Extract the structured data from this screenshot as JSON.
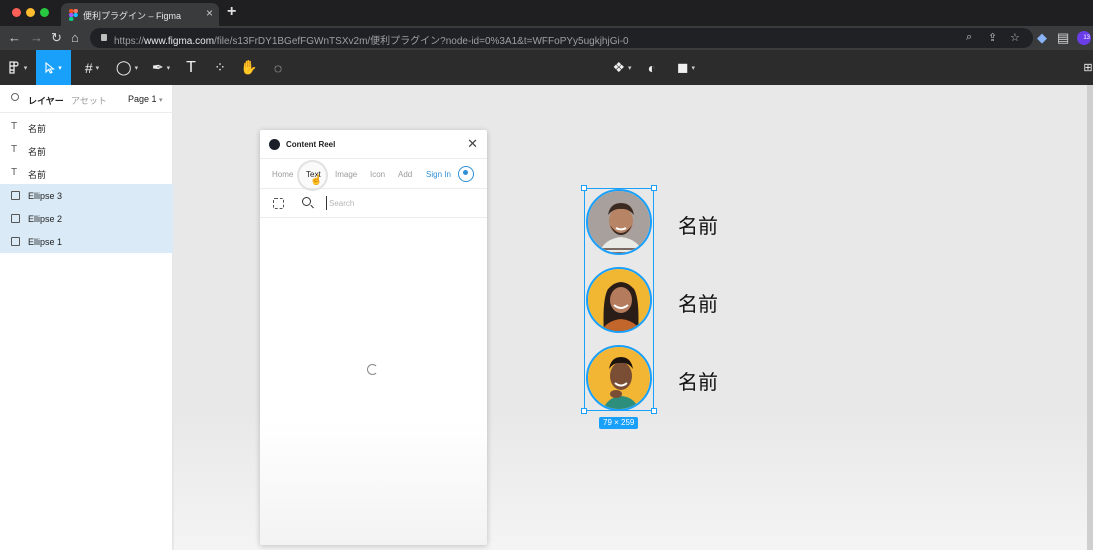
{
  "browser": {
    "tab_title": "便利プラグイン – Figma",
    "new_tab_glyph": "+",
    "url_prefix": "https://",
    "url_domain": "www.figma.com",
    "url_rest": "/file/s13FrDY1BGefFGWnTSXv2m/便利プラグイン?node-id=0%3A1&t=WFFoPYy5ugkjhjGi-0",
    "extension_badge": "13"
  },
  "layers_panel": {
    "tab_layers": "レイヤー",
    "tab_assets": "アセット",
    "page": "Page 1",
    "layers": [
      {
        "type": "text",
        "label": "名前",
        "selected": false
      },
      {
        "type": "text",
        "label": "名前",
        "selected": false
      },
      {
        "type": "text",
        "label": "名前",
        "selected": false
      },
      {
        "type": "image",
        "label": "Ellipse 3",
        "selected": true
      },
      {
        "type": "image",
        "label": "Ellipse 2",
        "selected": true
      },
      {
        "type": "image",
        "label": "Ellipse 1",
        "selected": true
      }
    ]
  },
  "plugin": {
    "title": "Content Reel",
    "close_glyph": "✕",
    "nav": [
      "Home",
      "Text",
      "Image",
      "Icon",
      "Add",
      "Sign In"
    ],
    "active_nav": "Text",
    "search_placeholder": "Search",
    "search_value": ""
  },
  "canvas": {
    "names": [
      "名前",
      "名前",
      "名前"
    ],
    "selection_size": "79 × 259",
    "avatar_colors": [
      "#a8a09c",
      "#f1b733",
      "#f3b634"
    ]
  },
  "colors": {
    "accent": "#18a0fb",
    "toolbar": "#2c2c2c",
    "signin": "#2d8fd5"
  }
}
